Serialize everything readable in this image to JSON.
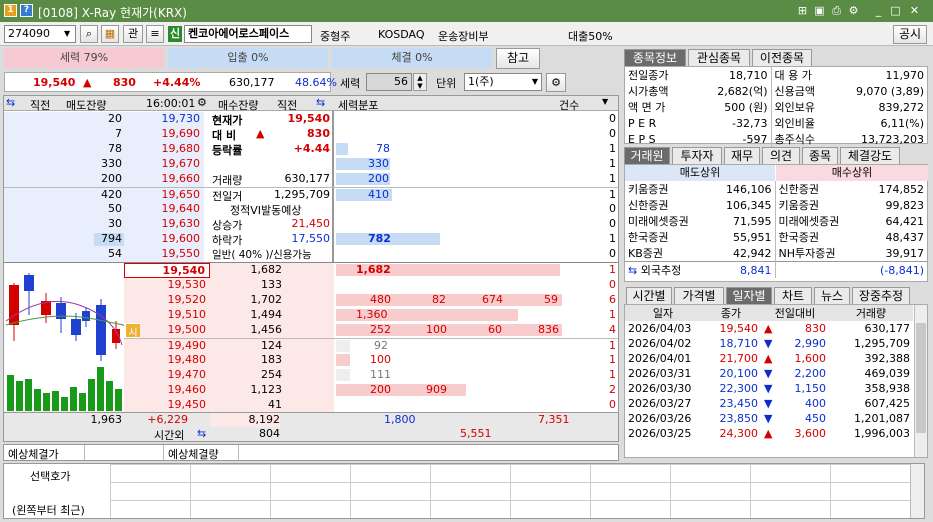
{
  "title": {
    "screen_no": "[0108]",
    "name": "X-Ray 현재가(KRX)"
  },
  "toolbar": {
    "code": "274090",
    "kwan": "관",
    "credit_badge": "신",
    "stock_name": "켄코아에어로스페이스",
    "chip1": "중형주",
    "chip2": "KOSDAQ",
    "chip3": "운송장비부",
    "loan": "대출50%",
    "notice": "공시"
  },
  "strength": {
    "seryeok_pct": "세력 79%",
    "inflow_pct": "입출 0%",
    "exec_pct": "체결 0%",
    "ref": "참고"
  },
  "price_row": {
    "price": "19,540",
    "arrow": "▲",
    "change": "830",
    "pct": "+4.44%",
    "volume": "630,177",
    "ratio": "48.64%"
  },
  "controls": {
    "seryeok_label": "세력",
    "seryeok_val": "56",
    "unit_label": "단위",
    "unit_val": "1(주)"
  },
  "ob_header": {
    "h1": "직전",
    "h2": "매도잔량",
    "time": "16:00:01",
    "h3": "매수잔량",
    "h4": "직전",
    "h5": "세력분포",
    "h6": "건수"
  },
  "asks": [
    {
      "qty": "20",
      "price": "19,730",
      "lab": "현재가",
      "val": "19,540",
      "dist": "",
      "cnt": "0"
    },
    {
      "qty": "7",
      "price": "19,690",
      "lab": "대  비",
      "val": "830",
      "dist": "",
      "cnt": "0"
    },
    {
      "qty": "78",
      "price": "19,680",
      "lab": "등락률",
      "val": "+4.44",
      "dist": "78",
      "cnt": "1"
    },
    {
      "qty": "330",
      "price": "19,670",
      "lab": "",
      "val": "",
      "dist": "330",
      "cnt": "1"
    },
    {
      "qty": "200",
      "price": "19,660",
      "lab": "거래량",
      "val": "630,177",
      "dist": "200",
      "cnt": "1"
    },
    {
      "qty": "420",
      "price": "19,650",
      "lab": "전일거",
      "val": "1,295,709",
      "dist": "410",
      "cnt": "1"
    },
    {
      "qty": "50",
      "price": "19,640",
      "lab": "정적VI발동예상",
      "val": "",
      "dist": "",
      "cnt": "0"
    },
    {
      "qty": "30",
      "price": "19,630",
      "lab": "상승가",
      "val": "21,450",
      "dist": "",
      "cnt": "0"
    },
    {
      "qty": "794",
      "price": "19,600",
      "lab": "하락가",
      "val": "17,550",
      "dist": "782",
      "cnt": "1"
    },
    {
      "qty": "54",
      "price": "19,550",
      "lab": "일반( 40% )/신용가능",
      "val": "",
      "dist": "",
      "cnt": "0"
    }
  ],
  "bids": [
    {
      "price": "19,540",
      "qty": "1,682",
      "d": [
        "1,682",
        "",
        "",
        ""
      ],
      "cnt": "1"
    },
    {
      "price": "19,530",
      "qty": "133",
      "d": [
        "",
        "",
        "",
        ""
      ],
      "cnt": "0"
    },
    {
      "price": "19,520",
      "qty": "1,702",
      "d": [
        "480",
        "82",
        "674",
        "59"
      ],
      "cnt": "6"
    },
    {
      "price": "19,510",
      "qty": "1,494",
      "d": [
        "1,360",
        "",
        "",
        ""
      ],
      "cnt": "1"
    },
    {
      "price": "19,500",
      "qty": "1,456",
      "d": [
        "252",
        "100",
        "60",
        "836"
      ],
      "cnt": "4"
    },
    {
      "price": "19,490",
      "qty": "124",
      "d": [
        "92",
        "",
        "",
        ""
      ],
      "cnt": "1"
    },
    {
      "price": "19,480",
      "qty": "183",
      "d": [
        "100",
        "",
        "",
        ""
      ],
      "cnt": "1"
    },
    {
      "price": "19,470",
      "qty": "254",
      "d": [
        "111",
        "",
        "",
        ""
      ],
      "cnt": "1"
    },
    {
      "price": "19,460",
      "qty": "1,123",
      "d": [
        "200",
        "909",
        "",
        ""
      ],
      "cnt": "2"
    },
    {
      "price": "19,450",
      "qty": "41",
      "d": [
        "",
        "",
        "",
        ""
      ],
      "cnt": "0"
    }
  ],
  "si_marker": "시",
  "totals": {
    "ask_total": "1,963",
    "net": "+6,229",
    "bid_total": "8,192",
    "after_label": "시간외",
    "after_val": "804",
    "dist1": "1,800",
    "dist2": "7,351",
    "dist3": "5,551"
  },
  "expected": {
    "price_label": "예상체결가",
    "qty_label": "예상체결량"
  },
  "bottom": {
    "line1": "선택호가",
    "line2": "(왼쪽부터 최근)"
  },
  "info_tabs": [
    "종목정보",
    "관심종목",
    "이전종목"
  ],
  "info": [
    {
      "k1": "전일종가",
      "v1": "18,710",
      "k2": "대 용 가",
      "v2": "11,970"
    },
    {
      "k1": "시가총액",
      "v1": "2,682(억)",
      "k2": "신용금액",
      "v2": "9,070  (3,89)"
    },
    {
      "k1": "액 면 가",
      "v1": "500 (원)",
      "k2": "외인보유",
      "v2": "839,272"
    },
    {
      "k1": "P E R",
      "v1": "-32,73",
      "k2": "외인비율",
      "v2": "6,11(%)"
    },
    {
      "k1": "E P S",
      "v1": "-597",
      "k2": "총주식수",
      "v2": "13,723,203"
    }
  ],
  "broker_tabs": [
    "거래원",
    "투자자",
    "재무",
    "의견",
    "종목",
    "체결강도"
  ],
  "broker_head": {
    "sell": "매도상위",
    "buy": "매수상위"
  },
  "brokers": [
    {
      "s": "키움증권",
      "sv": "146,106",
      "b": "신한증권",
      "bv": "174,852"
    },
    {
      "s": "신한증권",
      "sv": "106,345",
      "b": "키움증권",
      "bv": "99,823"
    },
    {
      "s": "미래에셋증권",
      "sv": "71,595",
      "b": "미래에셋증권",
      "bv": "64,421"
    },
    {
      "s": "한국증권",
      "sv": "55,951",
      "b": "한국증권",
      "bv": "48,437"
    },
    {
      "s": "KB증권",
      "sv": "42,942",
      "b": "NH투자증권",
      "bv": "39,917"
    }
  ],
  "foreign": {
    "label": "외국추정",
    "sell": "8,841",
    "buy": "(-8,841)"
  },
  "daily_tabs": [
    "시간별",
    "가격별",
    "일자별",
    "차트",
    "뉴스",
    "장중추정"
  ],
  "daily_head": [
    "일자",
    "종가",
    "전일대비",
    "거래량"
  ],
  "daily": [
    {
      "d": "2026/04/03",
      "c": "19,540",
      "a": "▲",
      "chg": "830",
      "v": "630,177",
      "up": true
    },
    {
      "d": "2026/04/02",
      "c": "18,710",
      "a": "▼",
      "chg": "2,990",
      "v": "1,295,709",
      "up": false
    },
    {
      "d": "2026/04/01",
      "c": "21,700",
      "a": "▲",
      "chg": "1,600",
      "v": "392,388",
      "up": true
    },
    {
      "d": "2026/03/31",
      "c": "20,100",
      "a": "▼",
      "chg": "2,200",
      "v": "469,039",
      "up": false
    },
    {
      "d": "2026/03/30",
      "c": "22,300",
      "a": "▼",
      "chg": "1,150",
      "v": "358,938",
      "up": false
    },
    {
      "d": "2026/03/27",
      "c": "23,450",
      "a": "▼",
      "chg": "400",
      "v": "607,425",
      "up": false
    },
    {
      "d": "2026/03/26",
      "c": "23,850",
      "a": "▼",
      "chg": "450",
      "v": "1,201,087",
      "up": false
    },
    {
      "d": "2026/03/25",
      "c": "24,300",
      "a": "▲",
      "chg": "3,600",
      "v": "1,996,003",
      "up": true
    }
  ],
  "colors": {
    "title_bg": "#5a8c46",
    "up": "#d40000",
    "down": "#0a2fcf",
    "ask_bg": "#e8eefc",
    "bid_bg": "#fde8e8"
  }
}
